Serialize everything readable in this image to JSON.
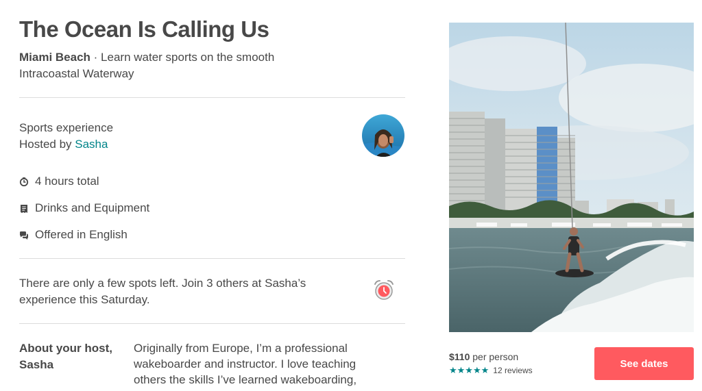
{
  "experience": {
    "title": "The Ocean Is Calling Us",
    "location": "Miami Beach",
    "separator": " · ",
    "tagline": "Learn water sports on the smooth Intracoastal Waterway",
    "category": "Sports experience",
    "hosted_by_prefix": "Hosted by ",
    "host_name": "Sasha"
  },
  "features": [
    {
      "icon": "clock-icon",
      "label": "4 hours total"
    },
    {
      "icon": "receipt-icon",
      "label": "Drinks and Equipment"
    },
    {
      "icon": "chat-bubbles-icon",
      "label": "Offered in English"
    }
  ],
  "availability": {
    "message": "There are only a few spots left. Join 3 others at Sasha’s experience this Saturday.",
    "icon": "alarm-clock-icon"
  },
  "about_host": {
    "label": "About your host, Sasha",
    "text": "Originally from Europe, I’m a professional wakeboarder and instructor. I love teaching others the skills I’ve learned wakeboarding,"
  },
  "booking": {
    "price": "$110",
    "price_unit": " per person",
    "rating_stars": 5,
    "reviews": "12 reviews",
    "cta_label": "See dates"
  },
  "colors": {
    "text": "#484848",
    "link": "#008489",
    "accent": "#ff5a5f",
    "divider": "#dcdcdc"
  }
}
